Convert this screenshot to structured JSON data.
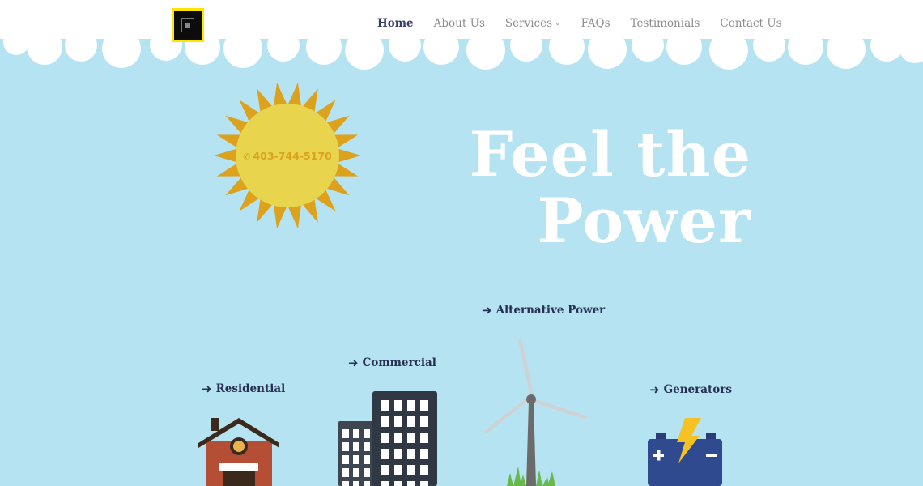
{
  "header": {
    "logo_name": "site-logo",
    "nav": [
      {
        "label": "Home",
        "active": true
      },
      {
        "label": "About Us"
      },
      {
        "label": "Services",
        "dropdown": true
      },
      {
        "label": "FAQs"
      },
      {
        "label": "Testimonials"
      },
      {
        "label": "Contact Us"
      }
    ]
  },
  "hero": {
    "phone": "403-744-5170",
    "headline_line1": "Feel the",
    "headline_line2": "Power"
  },
  "services": {
    "residential": "Residential",
    "commercial": "Commercial",
    "alternative": "Alternative Power",
    "generators": "Generators"
  },
  "colors": {
    "sky": "#b5e3f2",
    "sun_body": "#e8d44d",
    "sun_rays": "#dca21e",
    "nav_active": "#323f6b",
    "nav_text": "#8d8d8d",
    "logo_border": "#ffe400"
  }
}
